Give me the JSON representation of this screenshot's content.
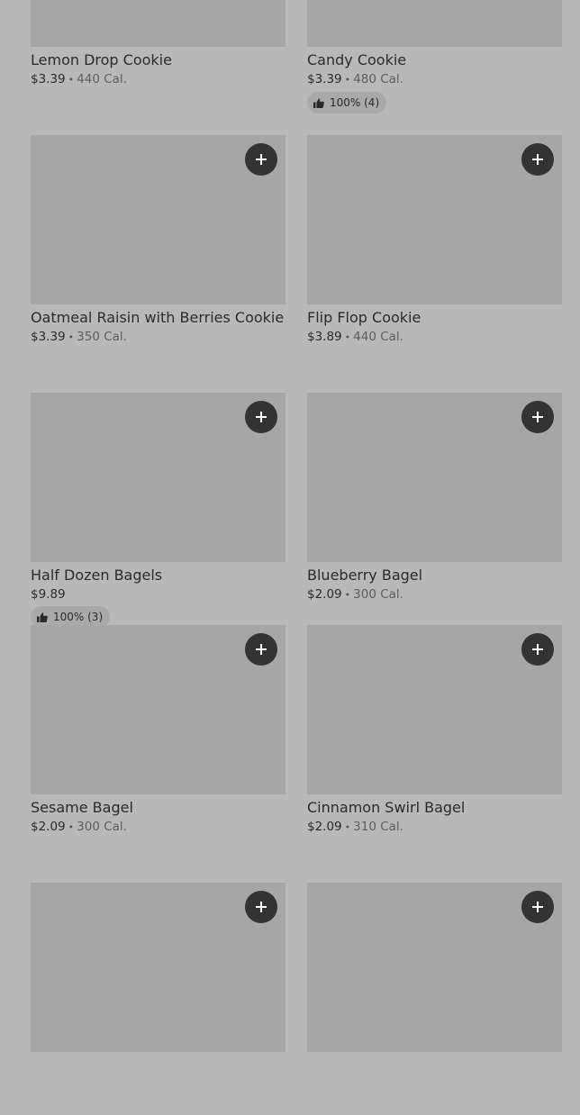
{
  "items": [
    {
      "name": "Lemon Drop Cookie",
      "price": "$3.39",
      "calories": "440 Cal.",
      "rating": ""
    },
    {
      "name": "Candy Cookie",
      "price": "$3.39",
      "calories": "480 Cal.",
      "rating": "100% (4)"
    },
    {
      "name": "Oatmeal Raisin with Berries Cookie",
      "price": "$3.39",
      "calories": "350 Cal.",
      "rating": ""
    },
    {
      "name": "Flip Flop Cookie",
      "price": "$3.89",
      "calories": "440 Cal.",
      "rating": ""
    },
    {
      "name": "Half Dozen Bagels",
      "price": "$9.89",
      "calories": "",
      "rating": "100% (3)"
    },
    {
      "name": "Blueberry Bagel",
      "price": "$2.09",
      "calories": "300 Cal.",
      "rating": ""
    },
    {
      "name": "Sesame Bagel",
      "price": "$2.09",
      "calories": "300 Cal.",
      "rating": ""
    },
    {
      "name": "Cinnamon Swirl Bagel",
      "price": "$2.09",
      "calories": "310 Cal.",
      "rating": ""
    },
    {
      "name": "",
      "price": "",
      "calories": "",
      "rating": ""
    },
    {
      "name": "",
      "price": "",
      "calories": "",
      "rating": ""
    }
  ],
  "icons": {
    "add": "plus-icon",
    "rating": "thumbs-up-icon"
  },
  "colors": {
    "background": "#b8b8b8",
    "image_placeholder": "#a6a6a6",
    "add_button": "#333333",
    "rating_badge": "#a9a9a9"
  }
}
